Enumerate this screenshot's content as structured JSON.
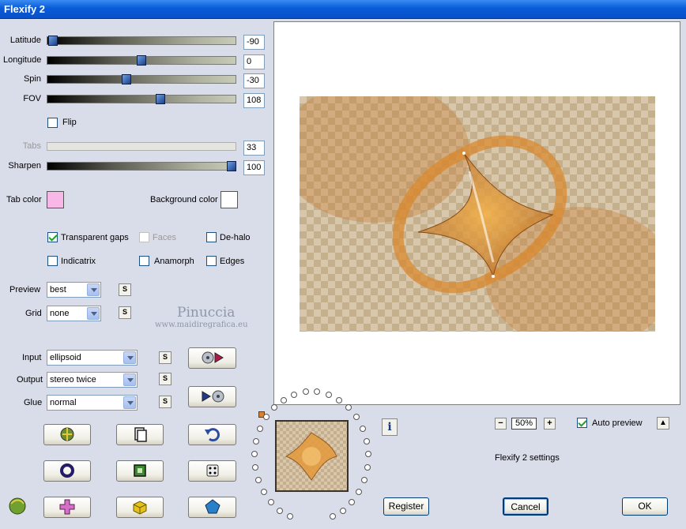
{
  "window": {
    "title": "Flexify 2"
  },
  "sliders": [
    {
      "label": "Latitude",
      "value": "-90",
      "fraction": 0.03,
      "disabled": false
    },
    {
      "label": "Longitude",
      "value": "0",
      "fraction": 0.5,
      "disabled": false
    },
    {
      "label": "Spin",
      "value": "-30",
      "fraction": 0.42,
      "disabled": false
    },
    {
      "label": "FOV",
      "value": "108",
      "fraction": 0.6,
      "disabled": false
    },
    {
      "label": "Tabs",
      "value": "33",
      "fraction": null,
      "disabled": true
    },
    {
      "label": "Sharpen",
      "value": "100",
      "fraction": 0.98,
      "disabled": false
    }
  ],
  "flip": {
    "label": "Flip",
    "checked": false
  },
  "tab_color": {
    "label": "Tab color",
    "color": "#F7B8E8"
  },
  "background_color": {
    "label": "Background color",
    "color": "#FFFFFF"
  },
  "options": {
    "transparent_gaps": {
      "label": "Transparent gaps",
      "checked": true
    },
    "faces": {
      "label": "Faces",
      "checked": false,
      "disabled": true
    },
    "de_halo": {
      "label": "De-halo",
      "checked": false
    },
    "indicatrix": {
      "label": "Indicatrix",
      "checked": false
    },
    "anamorph": {
      "label": "Anamorph",
      "checked": false
    },
    "edges": {
      "label": "Edges",
      "checked": false
    }
  },
  "preview": {
    "label": "Preview",
    "value": "best"
  },
  "grid": {
    "label": "Grid",
    "value": "none"
  },
  "watermark": {
    "line1": "Pinuccia",
    "line2": "www.maidiregrafica.eu"
  },
  "input": {
    "label": "Input",
    "value": "ellipsoid"
  },
  "output": {
    "label": "Output",
    "value": "stereo twice"
  },
  "glue": {
    "label": "Glue",
    "value": "normal"
  },
  "s_button": "S",
  "zoom": {
    "minus": "−",
    "value": "50%",
    "plus": "+"
  },
  "auto_preview": {
    "label": "Auto preview",
    "checked": true
  },
  "settings_name": "Flexify 2 settings",
  "info_glyph": "i",
  "buttons": {
    "register": "Register",
    "cancel": "Cancel",
    "ok": "OK"
  },
  "colors": {
    "accent": "#0A5BD8",
    "orange": "#D9822B"
  }
}
